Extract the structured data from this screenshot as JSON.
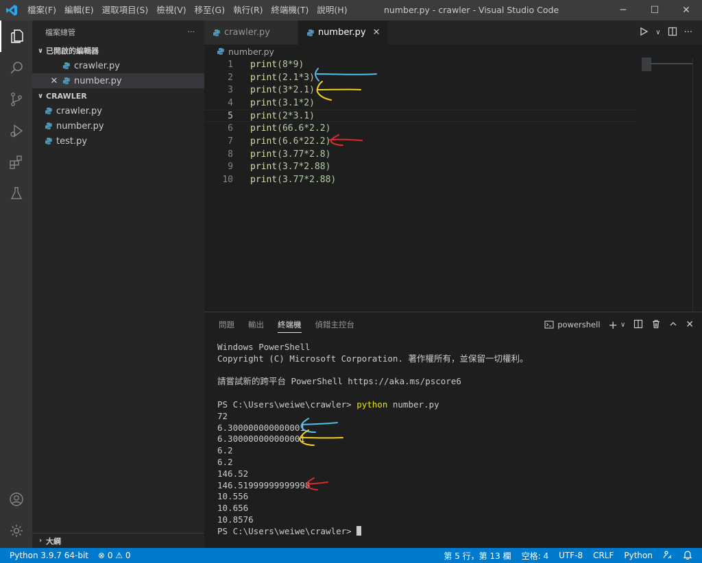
{
  "titlebar": {
    "menus": [
      "檔案(F)",
      "編輯(E)",
      "選取項目(S)",
      "檢視(V)",
      "移至(G)",
      "執行(R)",
      "終端機(T)",
      "說明(H)"
    ],
    "window_title": "number.py - crawler - Visual Studio Code",
    "minimize": "─",
    "maximize": "☐",
    "close": "✕"
  },
  "sidebar": {
    "header": "檔案總管",
    "more": "···",
    "open_editors_label": "已開啟的編輯器",
    "open_editors": [
      {
        "name": "crawler.py",
        "close": ""
      },
      {
        "name": "number.py",
        "close": "✕"
      }
    ],
    "folder_label": "CRAWLER",
    "files": [
      "crawler.py",
      "number.py",
      "test.py"
    ],
    "outline_label": "大綱"
  },
  "tabs": [
    {
      "label": "crawler.py",
      "active": false
    },
    {
      "label": "number.py",
      "active": true,
      "close": "✕"
    }
  ],
  "breadcrumb": "number.py",
  "code": [
    {
      "n": "1",
      "fn": "print",
      "args": "(8*9)"
    },
    {
      "n": "2",
      "fn": "print",
      "args": "(2.1*3)"
    },
    {
      "n": "3",
      "fn": "print",
      "args": "(3*2.1)"
    },
    {
      "n": "4",
      "fn": "print",
      "args": "(3.1*2)"
    },
    {
      "n": "5",
      "fn": "print",
      "args": "(2*3.1)"
    },
    {
      "n": "6",
      "fn": "print",
      "args": "(66.6*2.2)"
    },
    {
      "n": "7",
      "fn": "print",
      "args": "(6.6*22.2)"
    },
    {
      "n": "8",
      "fn": "print",
      "args": "(3.77*2.8)"
    },
    {
      "n": "9",
      "fn": "print",
      "args": "(3.7*2.88)"
    },
    {
      "n": "10",
      "fn": "print",
      "args": "(3.77*2.88)"
    }
  ],
  "panel": {
    "tabs": [
      "問題",
      "輸出",
      "終端機",
      "偵錯主控台"
    ],
    "active_tab": "終端機",
    "shell": "powershell"
  },
  "terminal": {
    "lines": [
      "Windows PowerShell",
      "Copyright (C) Microsoft Corporation. 著作權所有，並保留一切權利。",
      "",
      "請嘗試新的跨平台 PowerShell https://aka.ms/pscore6",
      ""
    ],
    "prompt": "PS C:\\Users\\weiwe\\crawler> ",
    "command": "python",
    "command_arg": " number.py",
    "outputs": [
      "72",
      "6.300000000000001",
      "6.300000000000001",
      "6.2",
      "6.2",
      "146.52",
      "146.51999999999998",
      "10.556",
      "10.656",
      "10.8576"
    ],
    "final_prompt": "PS C:\\Users\\weiwe\\crawler> "
  },
  "statusbar": {
    "python": "Python 3.9.7 64-bit",
    "errors": "⊗ 0 ⚠ 0",
    "position": "第 5 行，第 13 欄",
    "spaces": "空格: 4",
    "encoding": "UTF-8",
    "eol": "CRLF",
    "language": "Python"
  },
  "colors": {
    "accent": "#007acc",
    "annotation_blue": "#4fc1e9",
    "annotation_yellow": "#f2d21c",
    "annotation_red": "#e02b2b"
  }
}
